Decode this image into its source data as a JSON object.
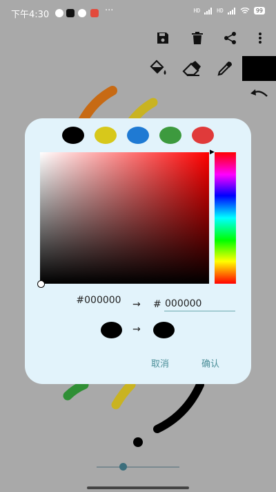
{
  "status_bar": {
    "time": "下午4:30",
    "dots": "···",
    "signal1": "HD",
    "signal2": "HD",
    "battery": "99"
  },
  "toolbar": {
    "icons": [
      "save-icon",
      "trash-icon",
      "share-icon",
      "more-vert-icon",
      "fill-bucket-icon",
      "eraser-icon",
      "eyedropper-icon",
      "undo-icon"
    ],
    "current_color": "#000000"
  },
  "color_picker": {
    "swatches": [
      "#000000",
      "#d7c81b",
      "#1f7ad3",
      "#3d9a3e",
      "#e03a3a"
    ],
    "old_hex": "#000000",
    "arrow": "→",
    "hex_prefix": "#",
    "new_hex": "000000",
    "old_color": "#000000",
    "new_color": "#000000",
    "cancel_label": "取消",
    "confirm_label": "确认"
  },
  "brush_size": {
    "value": 0.32
  }
}
